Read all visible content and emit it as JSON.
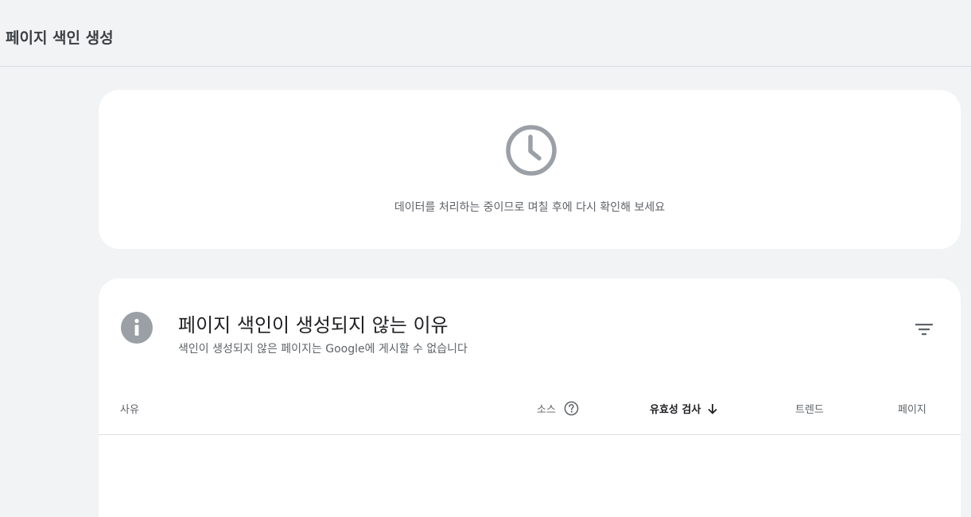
{
  "header": {
    "title": "페이지 색인 생성"
  },
  "processing_card": {
    "icon": "clock-icon",
    "message": "데이터를 처리하는 중이므로 며칠 후에 다시 확인해 보세요"
  },
  "reasons_card": {
    "icon": "info-icon",
    "title": "페이지 색인이 생성되지 않는 이유",
    "subtitle": "색인이 생성되지 않은 페이지는 Google에 게시할 수 없습니다",
    "filter_icon": "filter-icon",
    "columns": {
      "reason": "사유",
      "source": "소스",
      "validation": "유효성 검사",
      "trend": "트렌드",
      "pages": "페이지"
    },
    "sort_icon": "arrow-down-icon",
    "help_icon": "help-icon"
  },
  "colors": {
    "background": "#f1f3f4",
    "card": "#ffffff",
    "icon_gray": "#9aa0a6",
    "text_primary": "#202124",
    "text_secondary": "#5f6368"
  }
}
